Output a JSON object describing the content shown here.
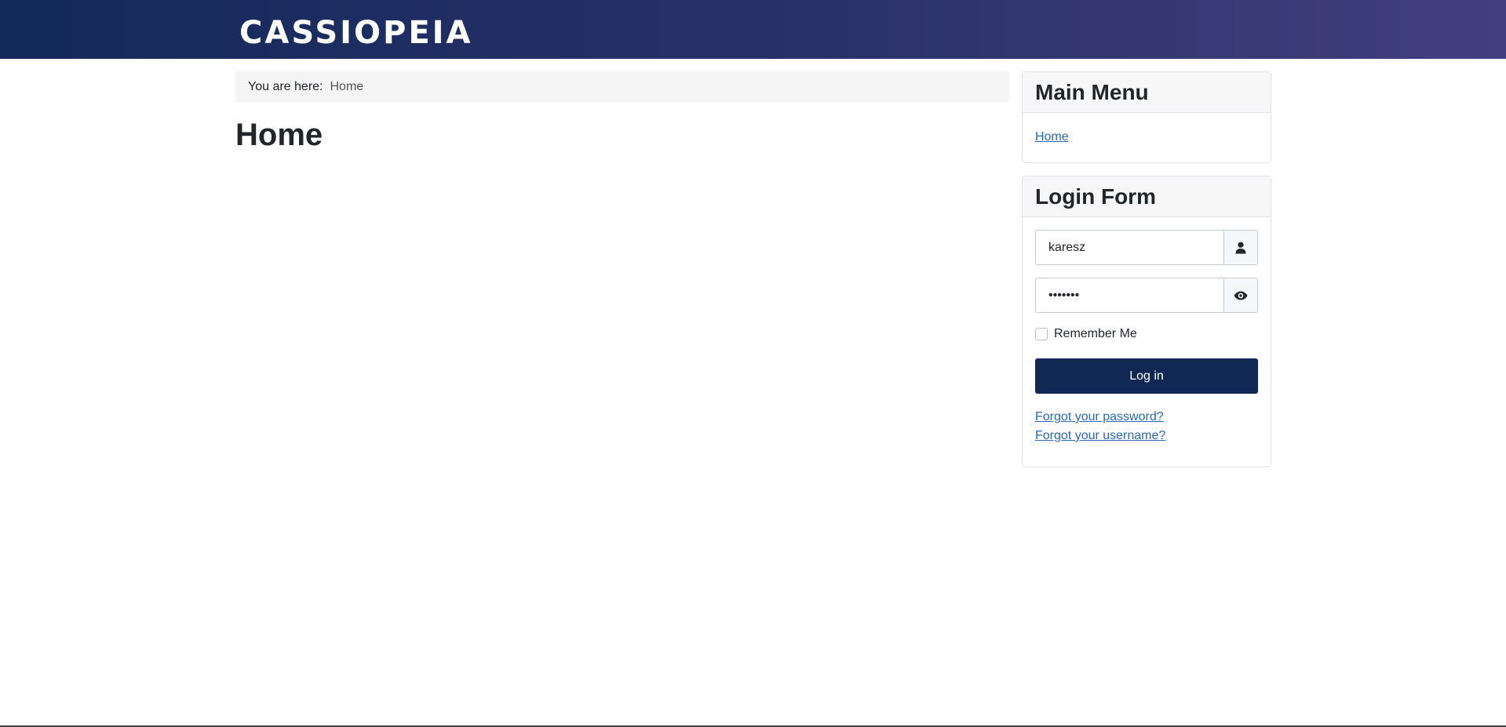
{
  "header": {
    "logo_text": "CASSIOPEIA",
    "gradient_colors": [
      "#132a5a",
      "#423f7e"
    ]
  },
  "breadcrumb": {
    "prefix": "You are here:",
    "current": "Home"
  },
  "page": {
    "title": "Home"
  },
  "main_menu": {
    "title": "Main Menu",
    "items": [
      {
        "label": "Home"
      }
    ]
  },
  "login_form": {
    "title": "Login Form",
    "username": {
      "value": "karesz",
      "icon": "user-icon"
    },
    "password": {
      "value": "•••••••",
      "icon": "eye-icon"
    },
    "remember_label": "Remember Me",
    "remember_checked": false,
    "submit_label": "Log in",
    "forgot_password_label": "Forgot your password?",
    "forgot_username_label": "Forgot your username?",
    "button_color": "#112855",
    "link_color": "#2a69b8"
  }
}
